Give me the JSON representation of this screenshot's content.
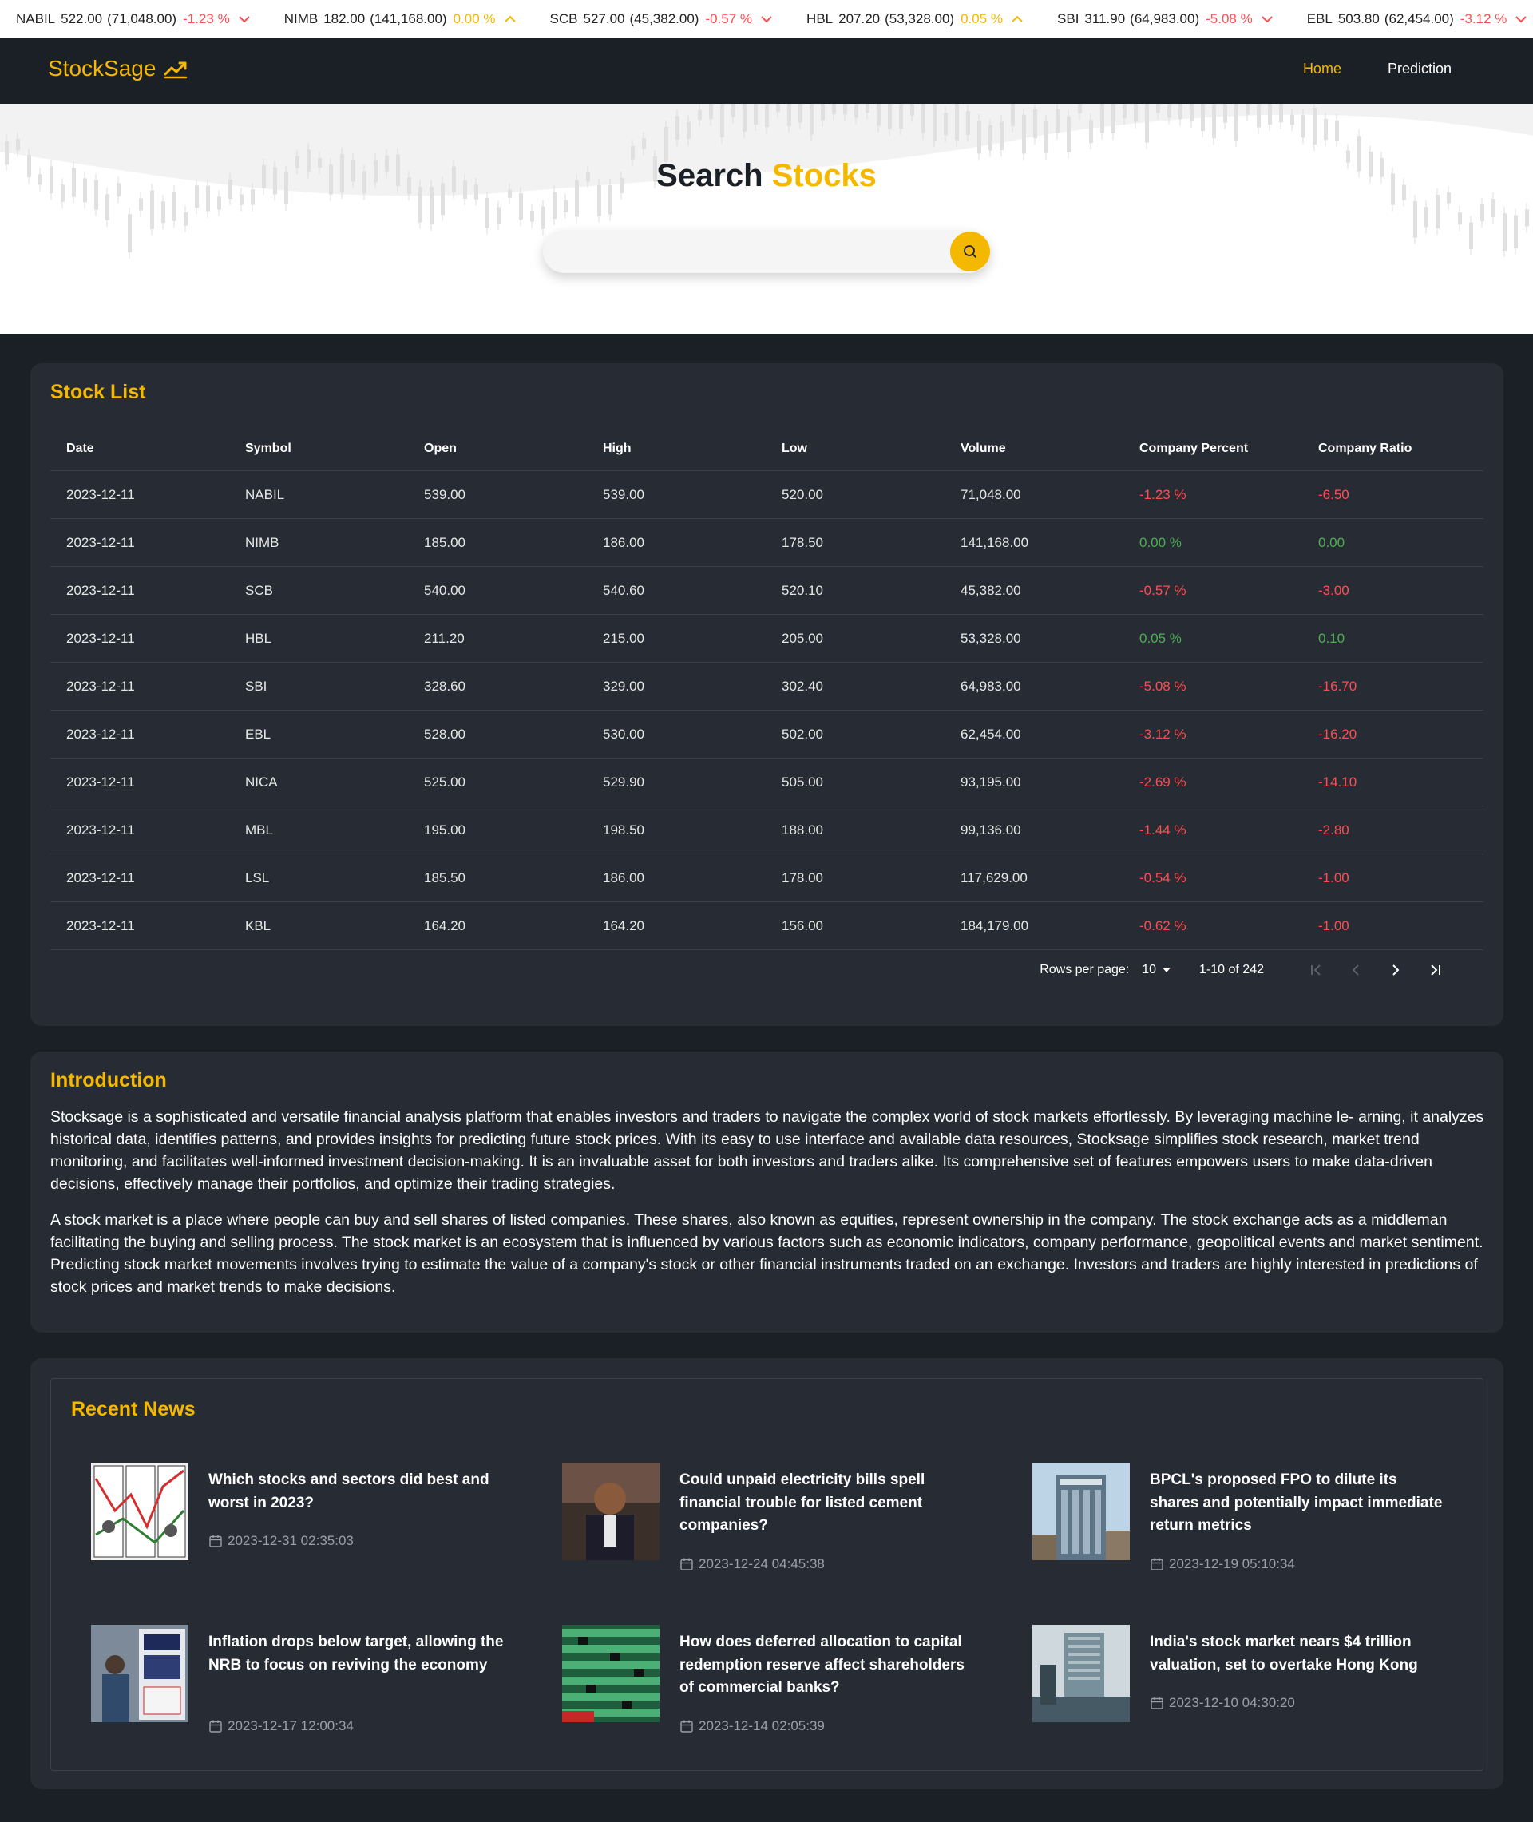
{
  "ticker": [
    {
      "symbol": "NABIL",
      "price": "522.00",
      "volume": "(71,048.00)",
      "change": "-1.23 %",
      "direction": "down"
    },
    {
      "symbol": "NIMB",
      "price": "182.00",
      "volume": "(141,168.00)",
      "change": "0.00 %",
      "direction": "flat"
    },
    {
      "symbol": "SCB",
      "price": "527.00",
      "volume": "(45,382.00)",
      "change": "-0.57 %",
      "direction": "down"
    },
    {
      "symbol": "HBL",
      "price": "207.20",
      "volume": "(53,328.00)",
      "change": "0.05 %",
      "direction": "up"
    },
    {
      "symbol": "SBI",
      "price": "311.90",
      "volume": "(64,983.00)",
      "change": "-5.08 %",
      "direction": "down"
    },
    {
      "symbol": "EBL",
      "price": "503.80",
      "volume": "(62,454.00)",
      "change": "-3.12 %",
      "direction": "down"
    }
  ],
  "nav": {
    "brand": "StockSage",
    "links": [
      "Home",
      "Prediction"
    ]
  },
  "hero": {
    "title_part1": "Search",
    "title_part2": "Stocks",
    "search_placeholder": "",
    "search_value": ""
  },
  "stock_list": {
    "title": "Stock List",
    "columns": [
      "Date",
      "Symbol",
      "Open",
      "High",
      "Low",
      "Volume",
      "Company Percent",
      "Company Ratio"
    ],
    "rows": [
      [
        "2023-12-11",
        "NABIL",
        "539.00",
        "539.00",
        "520.00",
        "71,048.00",
        "-1.23 %",
        "-6.50"
      ],
      [
        "2023-12-11",
        "NIMB",
        "185.00",
        "186.00",
        "178.50",
        "141,168.00",
        "0.00 %",
        "0.00"
      ],
      [
        "2023-12-11",
        "SCB",
        "540.00",
        "540.60",
        "520.10",
        "45,382.00",
        "-0.57 %",
        "-3.00"
      ],
      [
        "2023-12-11",
        "HBL",
        "211.20",
        "215.00",
        "205.00",
        "53,328.00",
        "0.05 %",
        "0.10"
      ],
      [
        "2023-12-11",
        "SBI",
        "328.60",
        "329.00",
        "302.40",
        "64,983.00",
        "-5.08 %",
        "-16.70"
      ],
      [
        "2023-12-11",
        "EBL",
        "528.00",
        "530.00",
        "502.00",
        "62,454.00",
        "-3.12 %",
        "-16.20"
      ],
      [
        "2023-12-11",
        "NICA",
        "525.00",
        "529.90",
        "505.00",
        "93,195.00",
        "-2.69 %",
        "-14.10"
      ],
      [
        "2023-12-11",
        "MBL",
        "195.00",
        "198.50",
        "188.00",
        "99,136.00",
        "-1.44 %",
        "-2.80"
      ],
      [
        "2023-12-11",
        "LSL",
        "185.50",
        "186.00",
        "178.00",
        "117,629.00",
        "-0.54 %",
        "-1.00"
      ],
      [
        "2023-12-11",
        "KBL",
        "164.20",
        "164.20",
        "156.00",
        "184,179.00",
        "-0.62 %",
        "-1.00"
      ]
    ],
    "pagination": {
      "rows_per_page_label": "Rows per page:",
      "rows_per_page": "10",
      "range": "1-10 of 242"
    }
  },
  "introduction": {
    "title": "Introduction",
    "paragraphs": [
      "Stocksage is a sophisticated and versatile financial analysis platform that enables investors and traders to navigate the complex world of stock markets effortlessly. By leveraging machine le- arning, it analyzes historical data, identifies patterns, and provides insights for predicting future stock prices. With its easy to use interface and available data resources, Stocksage simplifies stock research, market trend monitoring, and facilitates well-informed investment decision-making. It is an invaluable asset for both investors and traders alike. Its comprehensive set of features empowers users to make data-driven decisions, effectively manage their portfolios, and optimize their trading strategies.",
      "A stock market is a place where people can buy and sell shares of listed companies. These shares, also known as equities, represent ownership in the company. The stock exchange acts as a middleman facilitating the buying and selling process. The stock market is an ecosystem that is influenced by various factors such as economic indicators, company performance, geopolitical events and market sentiment. Predicting stock market movements involves trying to estimate the value of a company's stock or other financial instruments traded on an exchange. Investors and traders are highly interested in predictions of stock prices and market trends to make decisions."
    ]
  },
  "news": {
    "title": "Recent News",
    "items": [
      {
        "headline": "Which stocks and sectors did best and worst in 2023?",
        "date": "2023-12-31 02:35:03"
      },
      {
        "headline": "Could unpaid electricity bills spell financial trouble for listed cement companies?",
        "date": "2023-12-24 04:45:38"
      },
      {
        "headline": "BPCL's proposed FPO to dilute its shares and potentially impact immediate return metrics",
        "date": "2023-12-19 05:10:34"
      },
      {
        "headline": "Inflation drops below target, allowing the NRB to focus on reviving the economy",
        "date": "2023-12-17 12:00:34"
      },
      {
        "headline": "How does deferred allocation to capital redemption reserve affect shareholders of commercial banks?",
        "date": "2023-12-14 02:05:39"
      },
      {
        "headline": "India's stock market nears $4 trillion valuation, set to overtake Hong Kong",
        "date": "2023-12-10 04:30:20"
      }
    ]
  },
  "colors": {
    "accent": "#f5b800",
    "background": "#1b1f26",
    "card": "#272c34",
    "negative": "#ff4d4f",
    "positive": "#4caf50"
  }
}
